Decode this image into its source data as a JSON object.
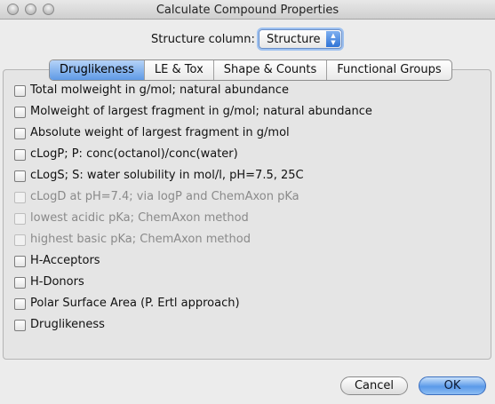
{
  "window": {
    "title": "Calculate Compound Properties"
  },
  "structure": {
    "label": "Structure column:",
    "selected": "Structure"
  },
  "tabs": [
    {
      "label": "Druglikeness",
      "active": true
    },
    {
      "label": "LE & Tox",
      "active": false
    },
    {
      "label": "Shape & Counts",
      "active": false
    },
    {
      "label": "Functional Groups",
      "active": false
    }
  ],
  "options": [
    {
      "label": "Total molweight in g/mol; natural abundance",
      "checked": false,
      "enabled": true
    },
    {
      "label": "Molweight of largest fragment in g/mol; natural abundance",
      "checked": false,
      "enabled": true
    },
    {
      "label": "Absolute weight of largest fragment in g/mol",
      "checked": false,
      "enabled": true
    },
    {
      "label": "cLogP; P: conc(octanol)/conc(water)",
      "checked": false,
      "enabled": true
    },
    {
      "label": "cLogS; S: water solubility in mol/l, pH=7.5, 25C",
      "checked": false,
      "enabled": true
    },
    {
      "label": "cLogD at pH=7.4; via logP and ChemAxon pKa",
      "checked": false,
      "enabled": false
    },
    {
      "label": "lowest acidic pKa; ChemAxon method",
      "checked": false,
      "enabled": false
    },
    {
      "label": "highest basic pKa; ChemAxon method",
      "checked": false,
      "enabled": false
    },
    {
      "label": "H-Acceptors",
      "checked": false,
      "enabled": true
    },
    {
      "label": "H-Donors",
      "checked": false,
      "enabled": true
    },
    {
      "label": "Polar Surface Area (P. Ertl approach)",
      "checked": false,
      "enabled": true
    },
    {
      "label": "Druglikeness",
      "checked": false,
      "enabled": true
    }
  ],
  "buttons": {
    "cancel_label": "Cancel",
    "ok_label": "OK"
  },
  "colors": {
    "accent": "#5f9ae6",
    "disabled_text": "#8a8a8a"
  }
}
